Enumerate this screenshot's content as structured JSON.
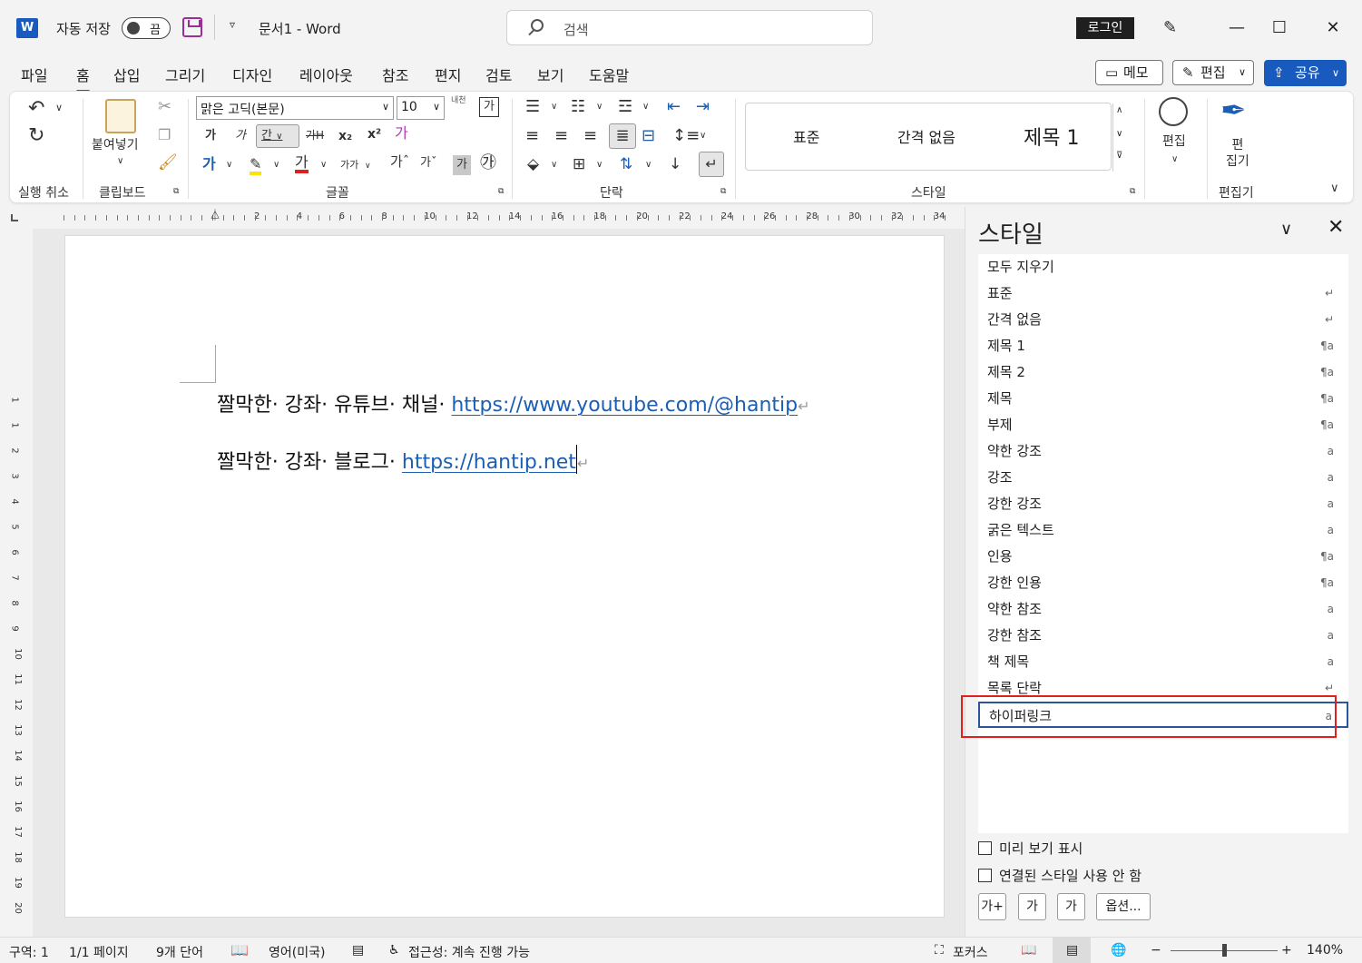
{
  "titlebar": {
    "app_icon": "W",
    "autosave_label": "자동 저장",
    "autosave_state": "끔",
    "qat_more": "▿",
    "doc_title": "문서1  -  Word",
    "search_placeholder": "검색",
    "login": "로그인",
    "minimize": "—",
    "maximize": "☐",
    "close": "✕"
  },
  "tabs": [
    "파일",
    "홈",
    "삽입",
    "그리기",
    "디자인",
    "레이아웃",
    "참조",
    "편지",
    "검토",
    "보기",
    "도움말"
  ],
  "actions": {
    "memo": "메모",
    "edit": "편집",
    "share": "공유"
  },
  "ribbon": {
    "groups": {
      "undo": "실행 취소",
      "clipboard": "클립보드",
      "font": "글꼴",
      "paragraph": "단락",
      "styles": "스타일",
      "editor": "편집기"
    },
    "paste_label": "붙여넣기",
    "font_name": "맑은 고딕(본문)",
    "font_size": "10",
    "font_btns": {
      "bold": "가",
      "italic": "가",
      "underline": "간",
      "strike": "가H",
      "sub": "x₂",
      "sup": "x²",
      "clear": "가",
      "color": "가",
      "size_grow": "가ˆ",
      "size_shrink": "가ˇ",
      "change_case": "가가",
      "char_shade": "가",
      "enclose": "㉮",
      "phonetic": "내천"
    },
    "style_gallery": [
      "표준",
      "간격 없음",
      "제목 1"
    ],
    "find_label": "편집",
    "editor_label": "편\n집기"
  },
  "ruler": {
    "h_numbers": [
      "2",
      "4",
      "6",
      "8",
      "10",
      "12",
      "14",
      "16",
      "18",
      "20",
      "22",
      "24",
      "26",
      "28",
      "30",
      "32",
      "34"
    ],
    "v_numbers": [
      "1",
      "1",
      "2",
      "3",
      "4",
      "5",
      "6",
      "7",
      "8",
      "9",
      "10",
      "11",
      "12",
      "13",
      "14",
      "15",
      "16",
      "17",
      "18",
      "19",
      "20"
    ]
  },
  "document": {
    "line1_text": "짤막한· 강좌· 유튜브· 채널· ",
    "line1_link": "https://www.youtube.com/@hantip",
    "line2_text": "짤막한· 강좌· 블로그· ",
    "line2_link": "https://hantip.net",
    "para_mark": "↵"
  },
  "style_pane": {
    "title": "스타일",
    "chevron": "∨",
    "close": "✕",
    "items": [
      {
        "name": "모두 지우기",
        "mark": ""
      },
      {
        "name": "표준",
        "mark": "↵"
      },
      {
        "name": "간격 없음",
        "mark": "↵"
      },
      {
        "name": "제목 1",
        "mark": "¶a"
      },
      {
        "name": "제목 2",
        "mark": "¶a"
      },
      {
        "name": "제목",
        "mark": "¶a"
      },
      {
        "name": "부제",
        "mark": "¶a"
      },
      {
        "name": "약한 강조",
        "mark": "a"
      },
      {
        "name": "강조",
        "mark": "a"
      },
      {
        "name": "강한 강조",
        "mark": "a"
      },
      {
        "name": "굵은 텍스트",
        "mark": "a"
      },
      {
        "name": "인용",
        "mark": "¶a"
      },
      {
        "name": "강한 인용",
        "mark": "¶a"
      },
      {
        "name": "약한 참조",
        "mark": "a"
      },
      {
        "name": "강한 참조",
        "mark": "a"
      },
      {
        "name": "책 제목",
        "mark": "a"
      },
      {
        "name": "목록 단락",
        "mark": "↵"
      },
      {
        "name": "하이퍼링크",
        "mark": "a"
      }
    ],
    "selected_item": "하이퍼링크",
    "preview_label": "미리 보기 표시",
    "linked_label": "연결된 스타일 사용 안 함",
    "btn_new": "가+",
    "btn_inspect": "가",
    "btn_manage": "가",
    "options": "옵션..."
  },
  "statusbar": {
    "section": "구역: 1",
    "page": "1/1 페이지",
    "words": "9개 단어",
    "language": "영어(미국)",
    "accessibility": "접근성: 계속 진행 가능",
    "focus": "포커스",
    "zoom_minus": "−",
    "zoom_plus": "+",
    "zoom": "140%"
  },
  "colors": {
    "accent": "#185abd",
    "link": "#1b5fb3",
    "highlight_box": "#e0201e"
  }
}
